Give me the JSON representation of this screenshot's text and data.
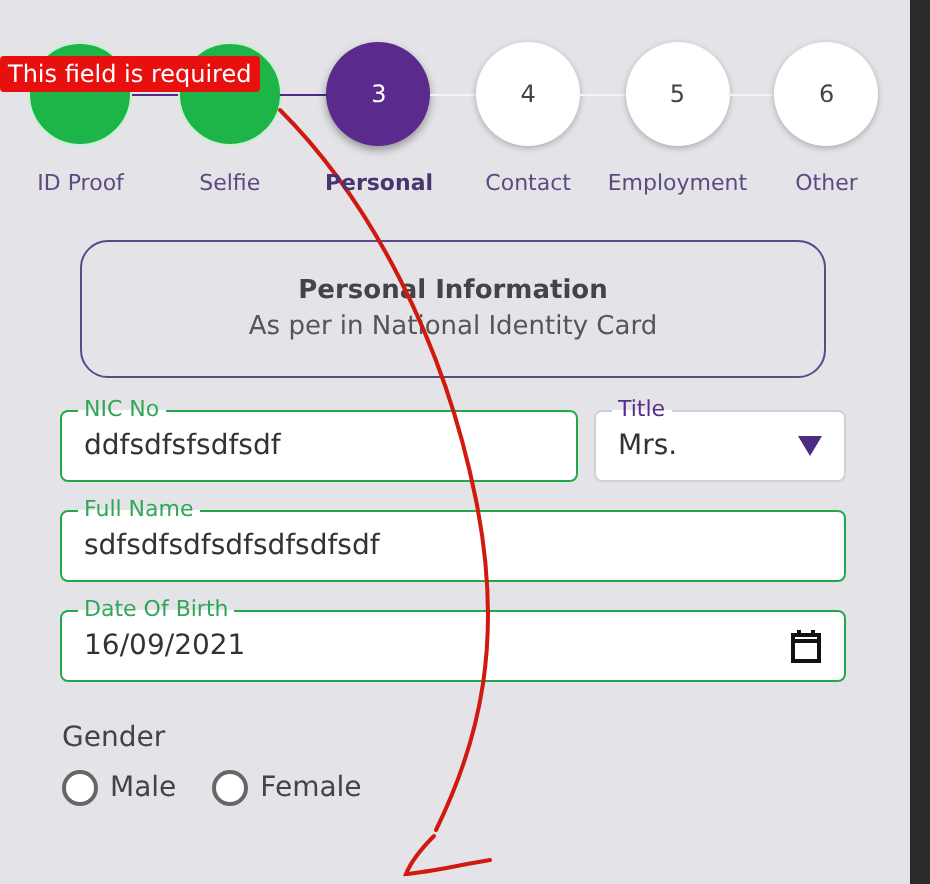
{
  "validation_tooltip": "This field is required",
  "steps": [
    {
      "label": "ID Proof",
      "completed": true,
      "selected": false
    },
    {
      "label": "Selfie",
      "completed": true,
      "selected": false
    },
    {
      "number": "3",
      "label": "Personal",
      "completed": false,
      "selected": true
    },
    {
      "number": "4",
      "label": "Contact",
      "completed": false,
      "selected": false
    },
    {
      "number": "5",
      "label": "Employment",
      "completed": false,
      "selected": false
    },
    {
      "number": "6",
      "label": "Other",
      "completed": false,
      "selected": false
    }
  ],
  "info_card": {
    "title": "Personal Information",
    "subtitle": "As per in National Identity Card"
  },
  "field_rows": [
    [
      {
        "kind": "text",
        "label": "NIC No",
        "value": "ddfsdfsfsdfsdf",
        "validated": true
      },
      {
        "kind": "select",
        "label": "Title",
        "value": "Mrs.",
        "validated": false
      }
    ],
    [
      {
        "kind": "text",
        "label": "Full Name",
        "value": "sdfsdfsdfsdfsdfsdfsdf",
        "validated": true
      }
    ],
    [
      {
        "kind": "date",
        "label": "Date Of Birth",
        "value": "16/09/2021",
        "validated": true
      }
    ]
  ],
  "gender": {
    "label": "Gender",
    "options": [
      {
        "label": "Male",
        "selected": false
      },
      {
        "label": "Female",
        "selected": false
      }
    ]
  }
}
